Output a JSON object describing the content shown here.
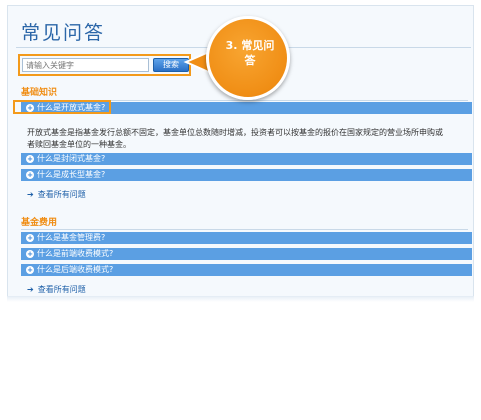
{
  "page": {
    "title": "常见问答"
  },
  "search": {
    "placeholder": "请输入关键字",
    "button": "搜索"
  },
  "callout": {
    "line1": "3. 常见问",
    "line2": "答"
  },
  "sections": [
    {
      "title": "基础知识",
      "questions": [
        {
          "label": "什么是开放式基金?",
          "expanded": true,
          "answer": "开放式基金是指基金发行总额不固定，基金单位总数随时增减，投资者可以按基金的报价在国家规定的营业场所申购或者赎回基金单位的一种基金。"
        },
        {
          "label": "什么是封闭式基金?"
        },
        {
          "label": "什么是成长型基金?"
        }
      ],
      "view_all": "查看所有问题"
    },
    {
      "title": "基金费用",
      "questions": [
        {
          "label": "什么是基金管理费?"
        },
        {
          "label": "什么是前端收费模式?"
        },
        {
          "label": "什么是后端收费模式?"
        }
      ],
      "view_all": "查看所有问题"
    }
  ],
  "colors": {
    "accent": "#f08e15",
    "bar": "#5b9fe3",
    "title": "#2b66a8"
  },
  "icons": {
    "question": "plus-circle-icon",
    "view_all": "arrow-right-icon"
  }
}
